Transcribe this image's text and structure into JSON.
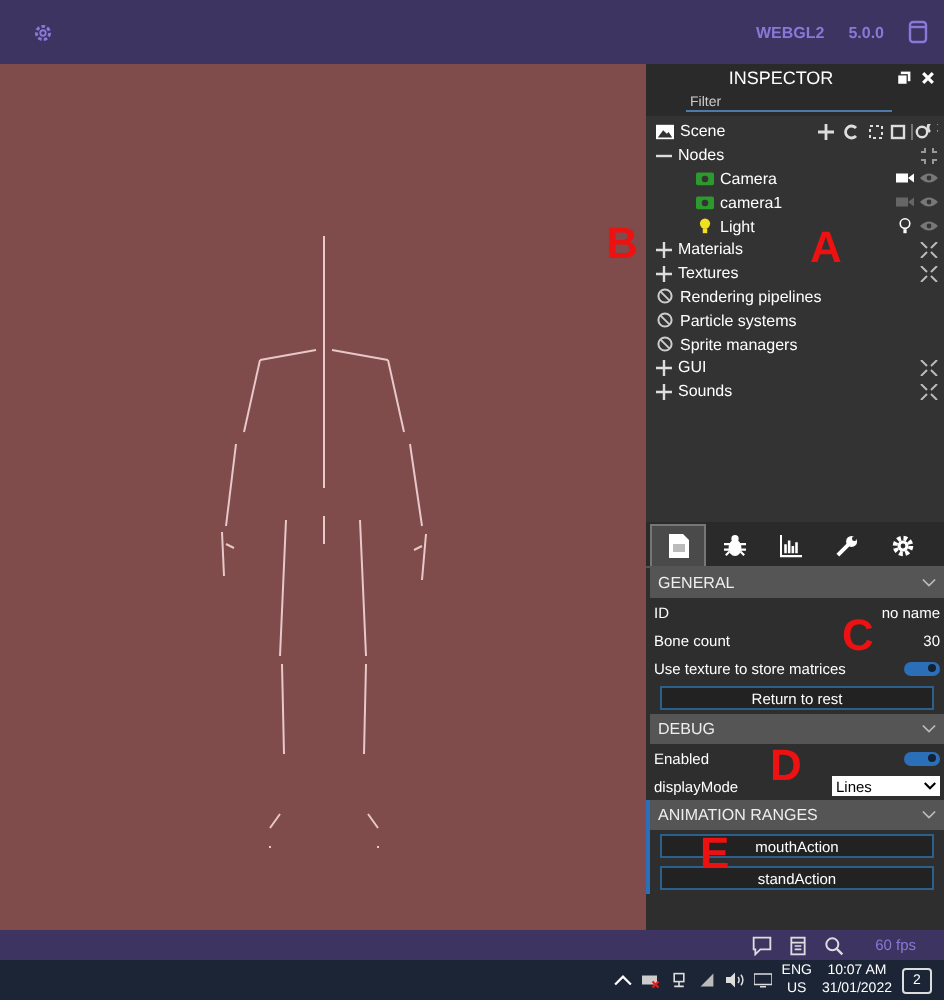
{
  "top_bar": {
    "badges": [
      "WEBGL2",
      "5.0.0"
    ]
  },
  "inspector": {
    "title": "INSPECTOR",
    "filter": {
      "placeholder": "Filter"
    },
    "scene": {
      "label": "Scene",
      "items": [
        {
          "label": "Nodes",
          "kind": "group",
          "expanded": true,
          "children": [
            {
              "label": "Camera",
              "kind": "camera",
              "active": true
            },
            {
              "label": "camera1",
              "kind": "camera",
              "active": false
            },
            {
              "label": "Light",
              "kind": "light",
              "active": true
            }
          ]
        },
        {
          "label": "Materials",
          "kind": "group",
          "expanded": false
        },
        {
          "label": "Textures",
          "kind": "group",
          "expanded": false
        },
        {
          "label": "Rendering pipelines",
          "kind": "empty"
        },
        {
          "label": "Particle systems",
          "kind": "empty"
        },
        {
          "label": "Sprite managers",
          "kind": "empty"
        },
        {
          "label": "GUI",
          "kind": "group",
          "expanded": false
        },
        {
          "label": "Sounds",
          "kind": "group",
          "expanded": false
        }
      ]
    },
    "tabs": [
      {
        "kind": "properties",
        "selected": true
      },
      {
        "kind": "debug",
        "selected": false
      },
      {
        "kind": "statistics",
        "selected": false
      },
      {
        "kind": "tools",
        "selected": false
      },
      {
        "kind": "settings",
        "selected": false
      }
    ],
    "sections": [
      {
        "title": "GENERAL",
        "highlighted": false,
        "rows": [
          {
            "kind": "text",
            "label": "ID",
            "value": "no name"
          },
          {
            "kind": "text",
            "label": "Bone count",
            "value": "30"
          },
          {
            "kind": "toggle",
            "label": "Use texture to store matrices",
            "on": true
          },
          {
            "kind": "button",
            "label": "Return to rest"
          }
        ]
      },
      {
        "title": "DEBUG",
        "highlighted": false,
        "rows": [
          {
            "kind": "toggle",
            "label": "Enabled",
            "on": true
          },
          {
            "kind": "select",
            "label": "displayMode",
            "value": "Lines"
          }
        ]
      },
      {
        "title": "ANIMATION RANGES",
        "highlighted": true,
        "rows": [
          {
            "kind": "button",
            "label": "mouthAction"
          },
          {
            "kind": "button",
            "label": "standAction"
          }
        ]
      }
    ]
  },
  "annotations": [
    "A",
    "B",
    "C",
    "D",
    "E"
  ],
  "bottom_bar": {
    "fps": "60 fps"
  },
  "taskbar": {
    "language": "ENG",
    "region": "US",
    "time": "10:07 AM",
    "date": "31/01/2022",
    "notifications": "2"
  }
}
